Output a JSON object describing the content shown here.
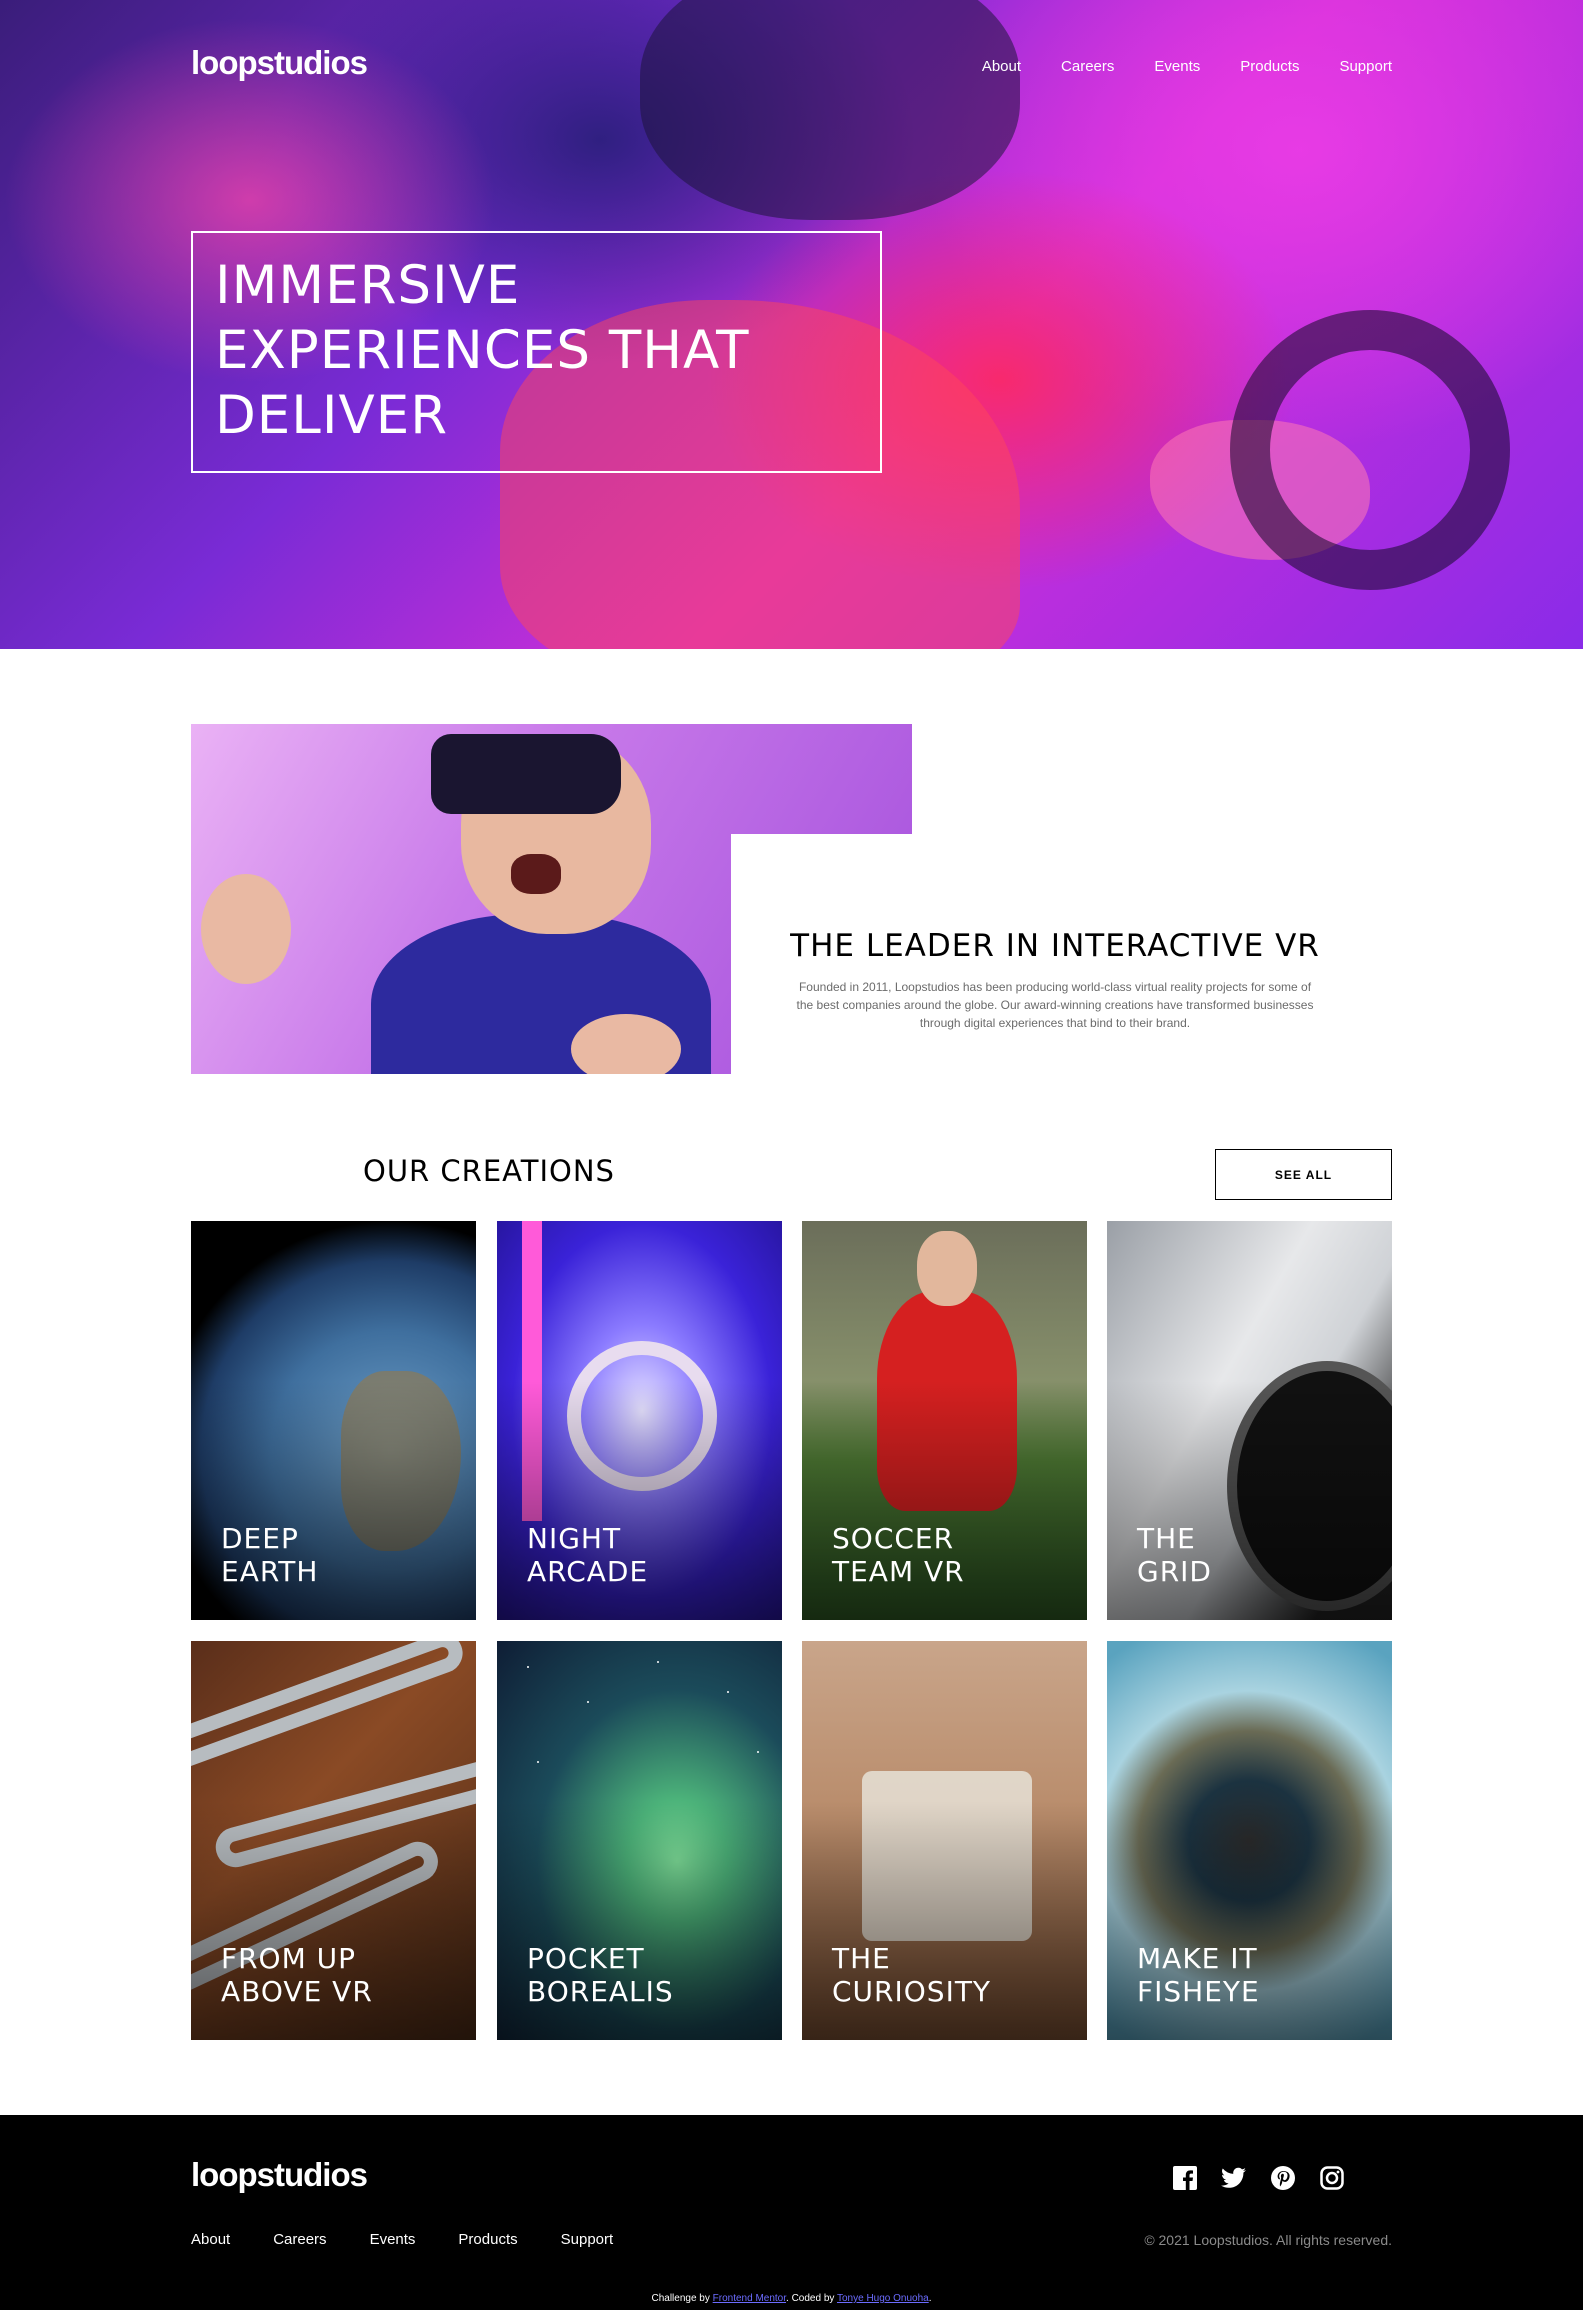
{
  "brand": {
    "logo_text": "loopstudios"
  },
  "nav": {
    "items": [
      "About",
      "Careers",
      "Events",
      "Products",
      "Support"
    ]
  },
  "hero": {
    "title": "IMMERSIVE EXPERIENCES THAT DELIVER"
  },
  "leader": {
    "title": "THE LEADER IN INTERACTIVE VR",
    "body": "Founded in 2011, Loopstudios has been producing world-class virtual reality projects for some of the best companies around the globe. Our award-winning creations have transformed businesses through digital experiences that bind to their brand."
  },
  "creations": {
    "title": "OUR CREATIONS",
    "see_all_label": "SEE ALL",
    "cards": [
      {
        "line1": "DEEP",
        "line2": "EARTH"
      },
      {
        "line1": "NIGHT",
        "line2": "ARCADE"
      },
      {
        "line1": "SOCCER",
        "line2": "TEAM VR"
      },
      {
        "line1": "THE",
        "line2": "GRID"
      },
      {
        "line1": "FROM UP",
        "line2": "ABOVE VR"
      },
      {
        "line1": "POCKET",
        "line2": "BOREALIS"
      },
      {
        "line1": "THE",
        "line2": "CURIOSITY"
      },
      {
        "line1": "MAKE IT",
        "line2": "FISHEYE"
      }
    ]
  },
  "footer": {
    "logo_text": "loopstudios",
    "nav": [
      "About",
      "Careers",
      "Events",
      "Products",
      "Support"
    ],
    "socials": [
      "facebook-icon",
      "twitter-icon",
      "pinterest-icon",
      "instagram-icon"
    ],
    "copyright": "© 2021 Loopstudios. All rights reserved.",
    "attribution": {
      "prefix": "Challenge by ",
      "challenge_link": "Frontend Mentor",
      "middle": ". Coded by ",
      "author_link": "Tonye Hugo Onuoha",
      "suffix": "."
    }
  },
  "colors": {
    "footer_bg": "#000000",
    "link_accent": "#6b6bff"
  }
}
